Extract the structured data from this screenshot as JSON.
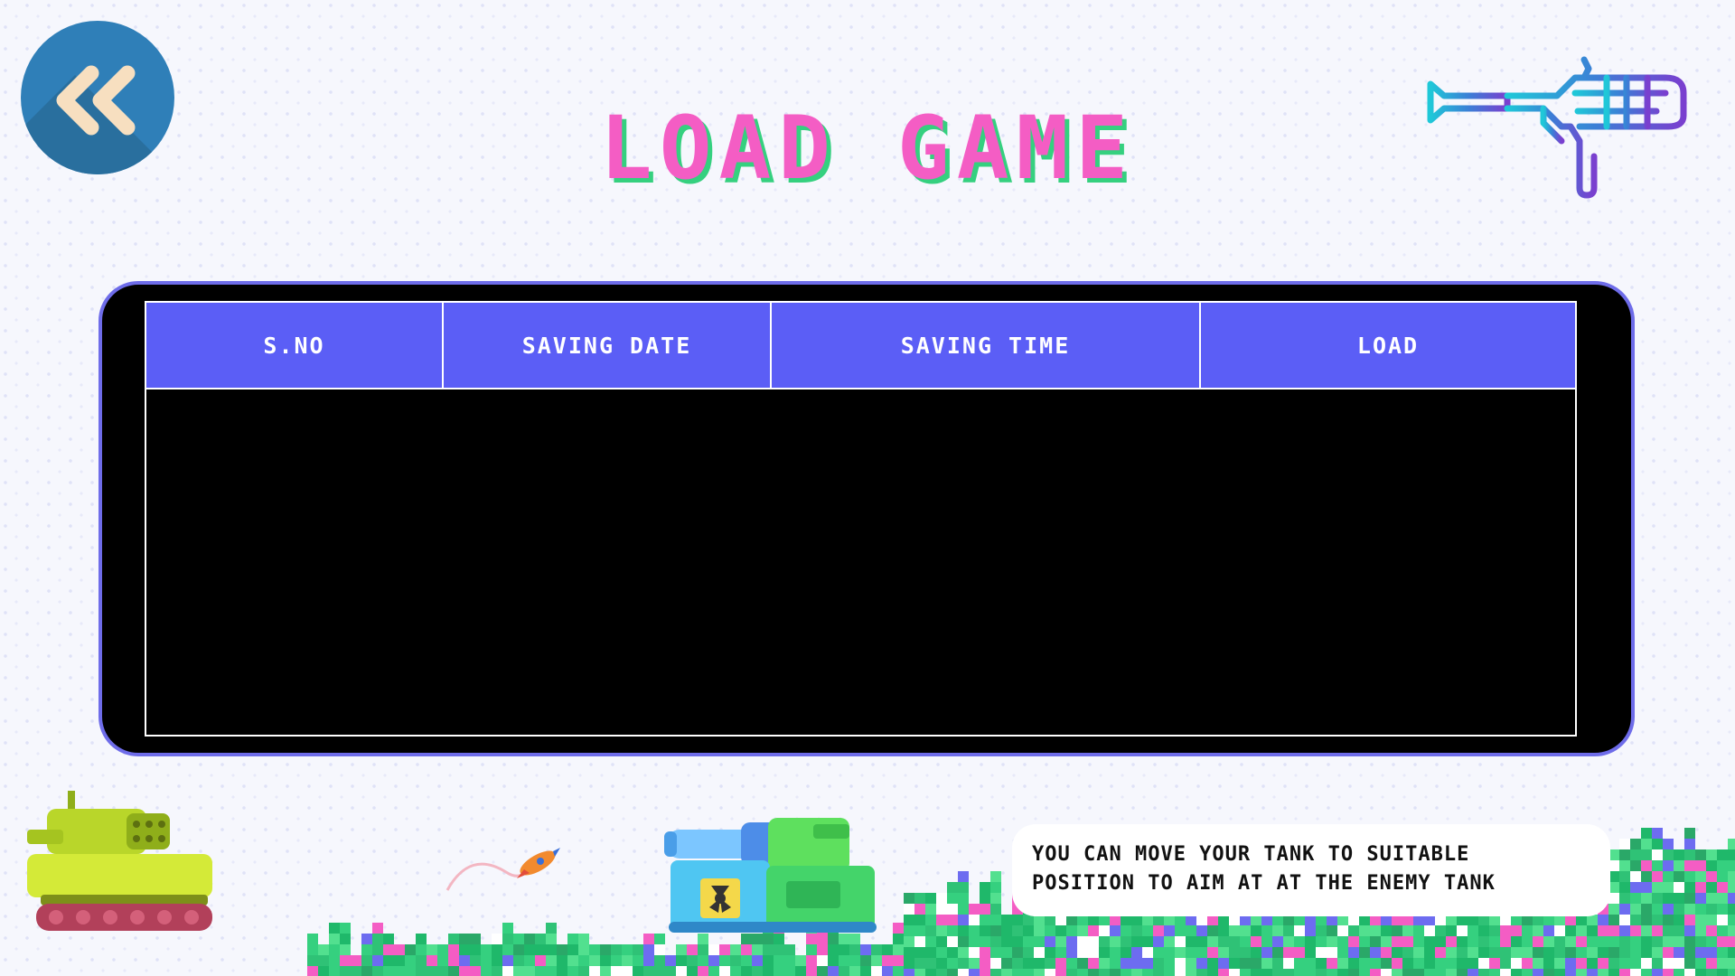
{
  "header": {
    "title": "LOAD GAME",
    "back_icon": "double-chevron-left-icon"
  },
  "table": {
    "columns": [
      "S.NO",
      "SAVING DATE",
      "SAVING TIME",
      "LOAD"
    ],
    "rows": []
  },
  "hint": {
    "line1": "YOU CAN MOVE YOUR TANK TO SUITABLE",
    "line2": "POSITION TO AIM AT AT THE ENEMY TANK"
  },
  "colors": {
    "title": "#f45dc4",
    "title_shadow": "#35d07f",
    "table_header": "#5b5ef6",
    "panel_border": "#6e6ce9",
    "back_button": "#2f7fb8"
  }
}
